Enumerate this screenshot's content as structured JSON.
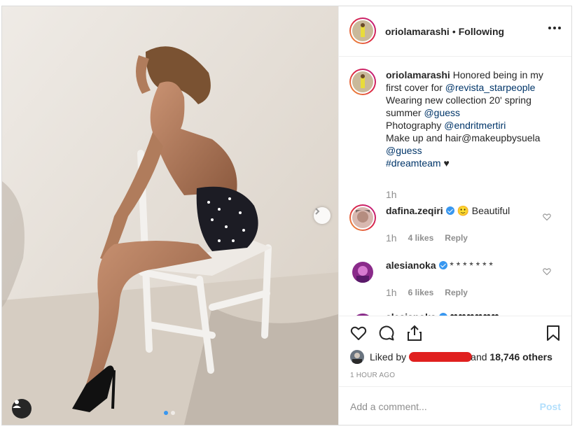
{
  "header": {
    "username": "oriolamarashi",
    "separator": "•",
    "follow_status": "Following"
  },
  "caption": {
    "username": "oriolamarashi",
    "text_1": "Honored being in my first cover for",
    "mention_1": "@revista_starpeople",
    "text_2": "Wearing new collection 20' spring summer",
    "mention_2": "@guess",
    "text_3": "Photography",
    "mention_3": "@endritmertiri",
    "text_4": "Make up and hair@makeupbysuela",
    "mention_4": "@guess",
    "hashtag": "#dreamteam",
    "heart": "♥",
    "time": "1h"
  },
  "comments": [
    {
      "username": "dafina.zeqiri",
      "text": "🙂 Beautiful",
      "time": "1h",
      "likes": "4 likes",
      "reply": "Reply"
    },
    {
      "username": "alesianoka",
      "text": "* * * * * * *",
      "time": "1h",
      "likes": "6 likes",
      "reply": "Reply"
    },
    {
      "username": "alesianoka",
      "text": "❤❤❤❤❤❤"
    }
  ],
  "likes": {
    "prefix": "Liked by",
    "suffix": "and",
    "count": "18,746 others"
  },
  "timestamp": "1 HOUR AGO",
  "add_comment": {
    "placeholder": "Add a comment...",
    "post_label": "Post"
  },
  "carousel": {
    "current": 1,
    "total": 2
  },
  "colors": {
    "link": "#003569",
    "accent": "#3897f0",
    "muted": "#8e8e8e",
    "post_disabled": "#b2dffc"
  },
  "icons": [
    "more-icon",
    "heart-icon",
    "comment-icon",
    "share-icon",
    "bookmark-icon",
    "chevron-right-icon",
    "user-tag-icon",
    "verified-icon"
  ]
}
